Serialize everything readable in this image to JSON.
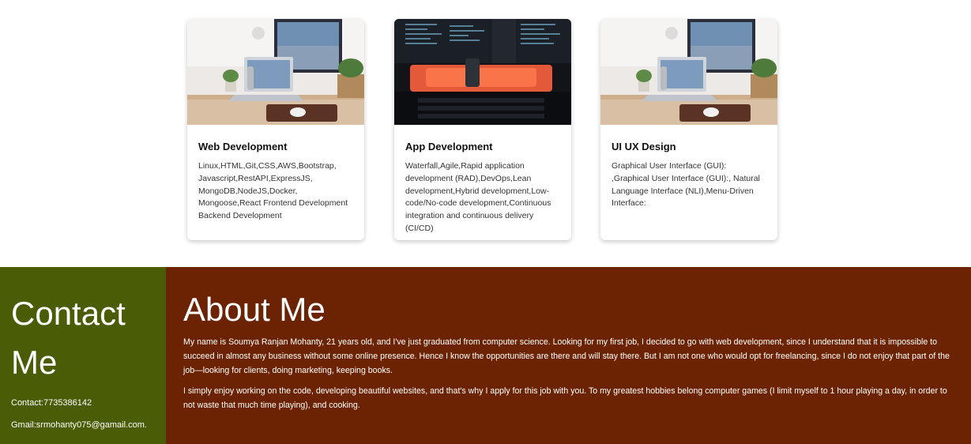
{
  "colors": {
    "contact_bg": "#4a5c06",
    "about_bg": "#6b2304",
    "card_bg": "#ffffff"
  },
  "cards": [
    {
      "title": "Web Development",
      "image_icon": "laptop-desk-photo",
      "text": "Linux,HTML,Git,CSS,AWS,Bootstrap, Javascript,RestAPI,ExpressJS, MongoDB,NodeJS,Docker, Mongoose,React Frontend Development Backend Development"
    },
    {
      "title": "App Development",
      "image_icon": "code-screen-photo",
      "text": "Waterfall,Agile,Rapid application development (RAD),DevOps,Lean development,Hybrid development,Low-code/No-code development,Continuous integration and continuous delivery (CI/CD)"
    },
    {
      "title": "UI UX Design",
      "image_icon": "laptop-desk-photo",
      "text": "Graphical User Interface (GUI): ,Graphical User Interface (GUI):, Natural Language Interface (NLI),Menu-Driven Interface:"
    }
  ],
  "contact": {
    "title": "Contact Me",
    "phone": "Contact:7735386142",
    "email": "Gmail:srmohanty075@gamail.com."
  },
  "about": {
    "title": "About Me",
    "paragraph1": "My name is Soumya Ranjan Mohanty, 21 years old, and I've just graduated from computer science. Looking for my first job, I decided to go with web development, since I understand that it is impossible to succeed in almost any business without some online presence. Hence I know the opportunities are there and will stay there. But I am not one who would opt for freelancing, since I do not enjoy that part of the job—looking for clients, doing marketing, keeping books.",
    "paragraph2": "I simply enjoy working on the code, developing beautiful websites, and that's why I apply for this job with you. To my greatest hobbies belong computer games (I limit myself to 1 hour playing a day, in order to not waste that much time playing), and cooking."
  }
}
